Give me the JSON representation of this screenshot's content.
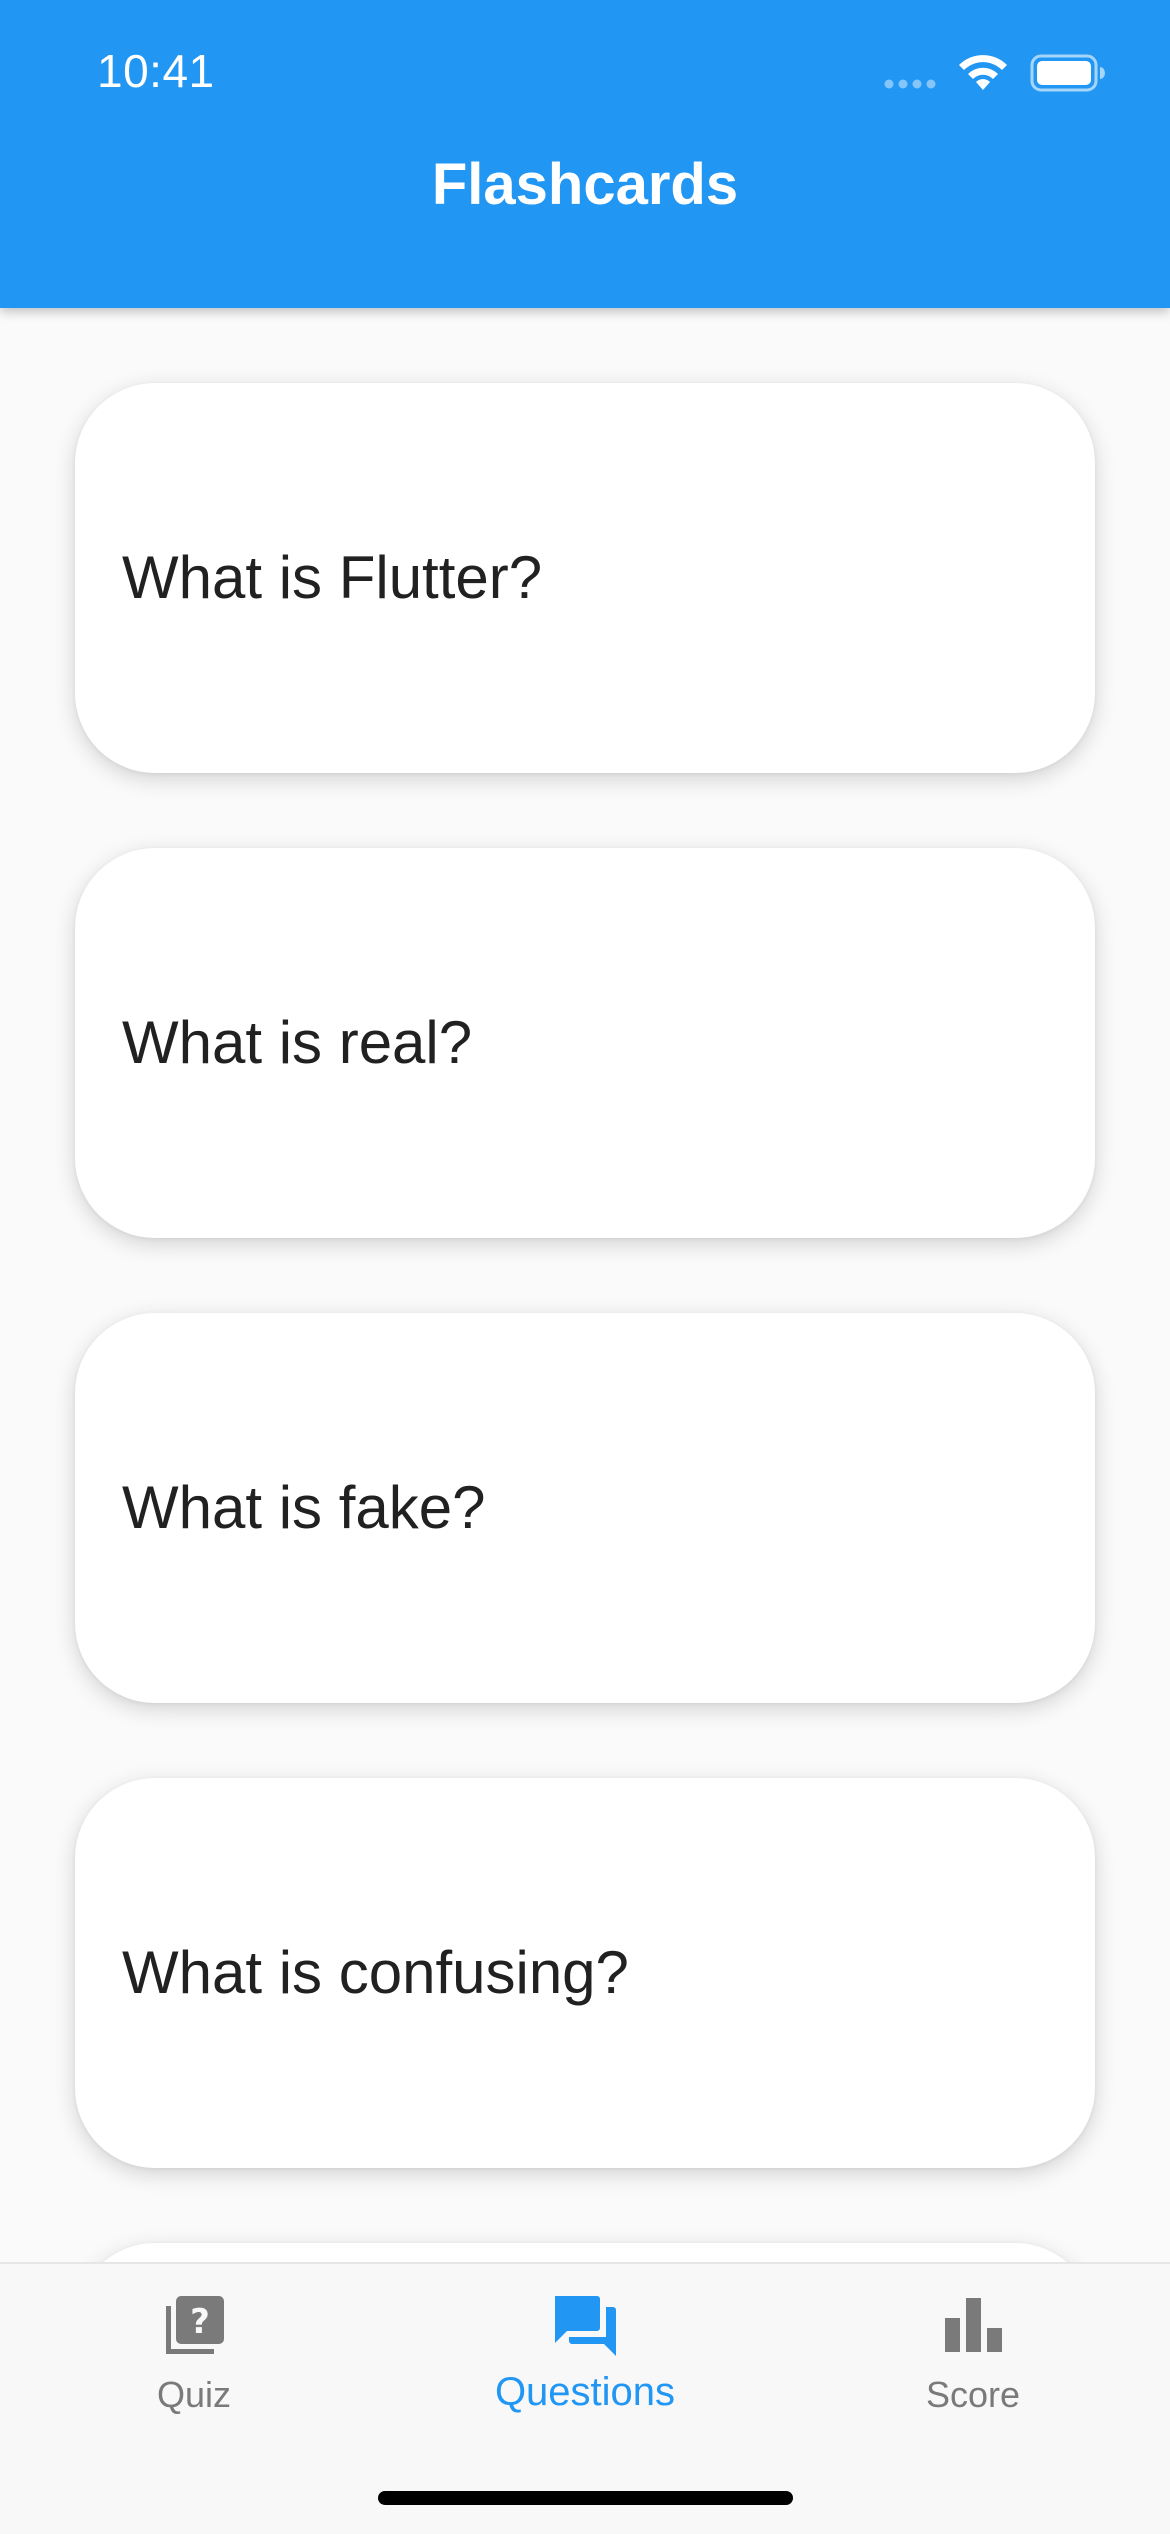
{
  "status_bar": {
    "time": "10:41",
    "icons": [
      "signal-dots-icon",
      "wifi-icon",
      "battery-icon"
    ]
  },
  "app_bar": {
    "title": "Flashcards",
    "color": "#2196f3"
  },
  "cards": [
    {
      "question": "What is Flutter?"
    },
    {
      "question": "What is real?"
    },
    {
      "question": "What is fake?"
    },
    {
      "question": "What is confusing?"
    },
    {
      "question": ""
    }
  ],
  "bottom_nav": {
    "active_color": "#2196f3",
    "inactive_color": "#7a7a7a",
    "items": [
      {
        "label": "Quiz",
        "icon": "quiz-icon",
        "active": false
      },
      {
        "label": "Questions",
        "icon": "forum-icon",
        "active": true
      },
      {
        "label": "Score",
        "icon": "bar-chart-icon",
        "active": false
      }
    ]
  }
}
